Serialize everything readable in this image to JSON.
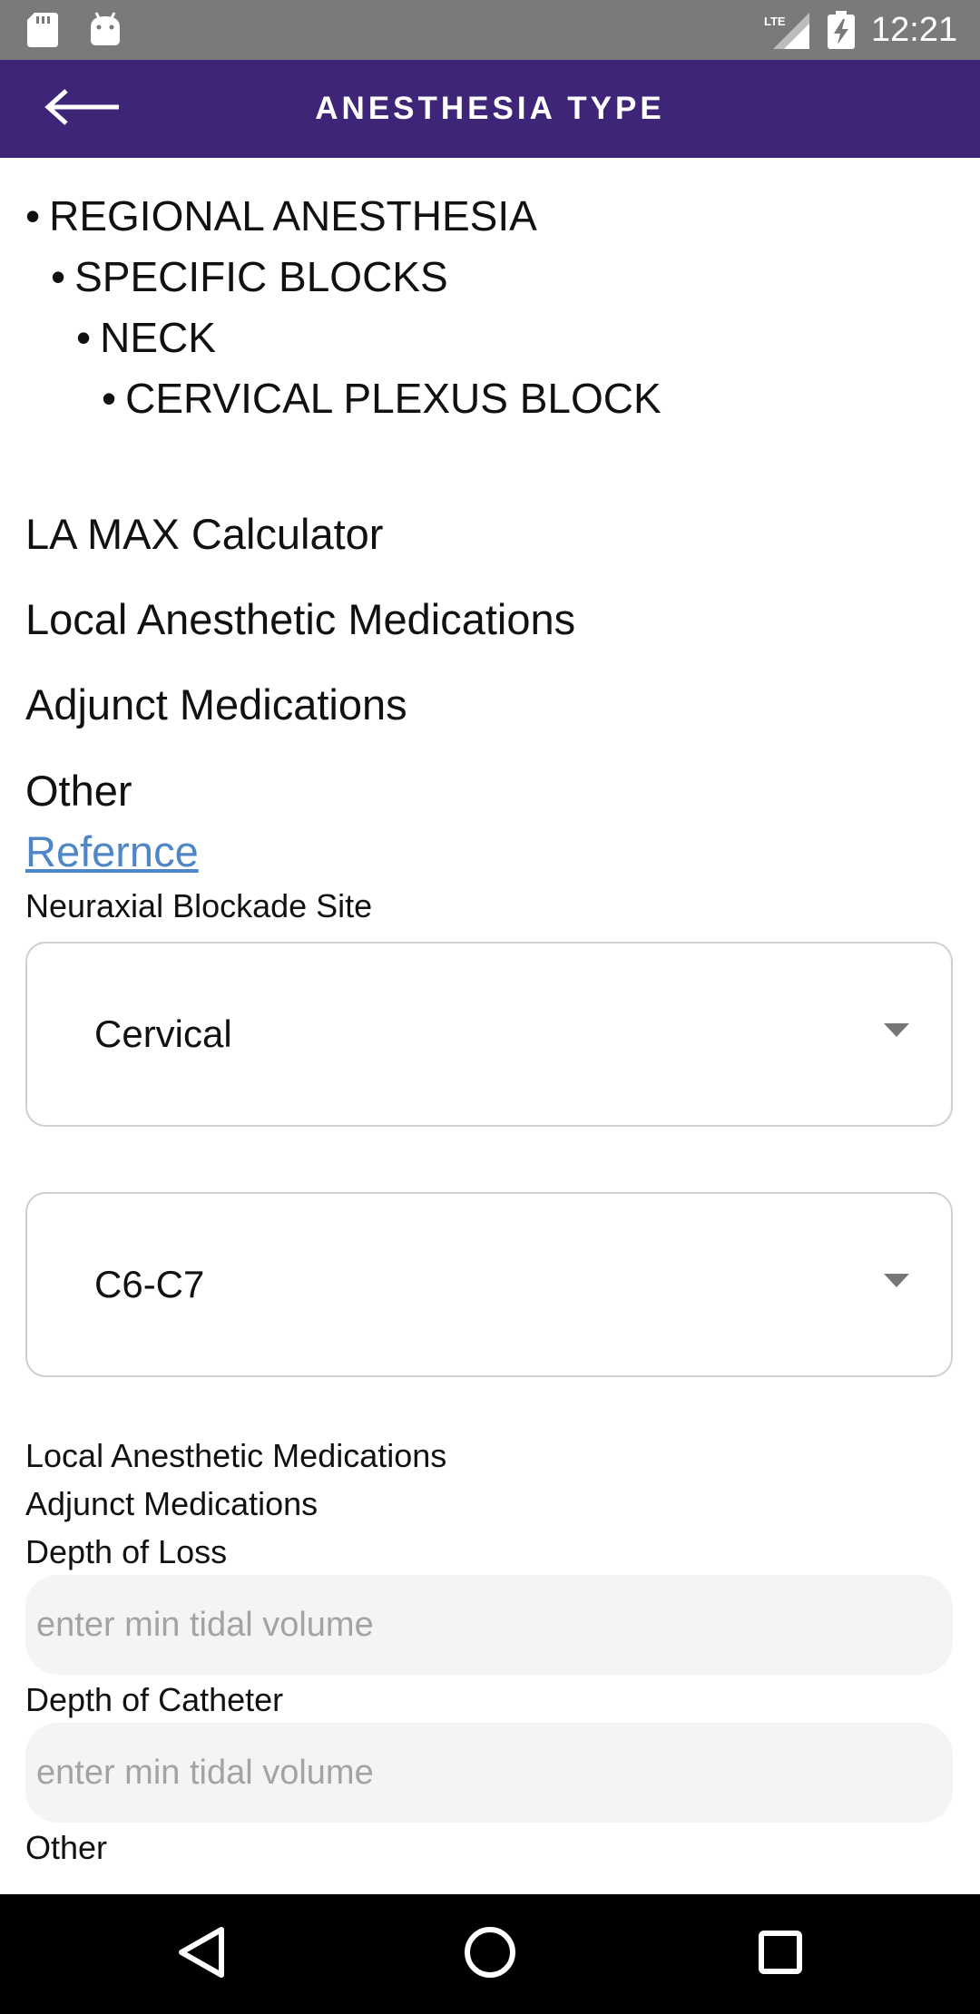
{
  "status_bar": {
    "time": "12:21",
    "network": "LTE",
    "icons": [
      "sd-card-icon",
      "android-icon",
      "lte-signal-icon",
      "battery-charging-icon"
    ]
  },
  "app_bar": {
    "title": "ANESTHESIA TYPE",
    "back_icon": "arrow-left-icon",
    "background_color": "#3f2577"
  },
  "breadcrumb": [
    "REGIONAL ANESTHESIA",
    "SPECIFIC BLOCKS",
    "NECK",
    "CERVICAL PLEXUS BLOCK"
  ],
  "bullet": "•",
  "sections": {
    "la_max_calculator": "LA MAX Calculator",
    "local_anesthetic_medications": "Local Anesthetic Medications",
    "adjunct_medications": "Adjunct Medications",
    "other": "Other"
  },
  "reference_link": {
    "label": "Refernce",
    "color": "#4f86c6"
  },
  "form": {
    "neuraxial_label": "Neuraxial Blockade Site",
    "site_select": {
      "selected": "Cervical"
    },
    "level_select": {
      "selected": "C6-C7"
    },
    "local_anesthetic_label": "Local Anesthetic Medications",
    "adjunct_label": "Adjunct Medications",
    "depth_of_loss": {
      "label": "Depth of Loss",
      "value": "",
      "placeholder": "enter min tidal volume"
    },
    "depth_of_catheter": {
      "label": "Depth of Catheter",
      "value": "",
      "placeholder": "enter min tidal volume"
    },
    "other_label": "Other"
  },
  "nav_bar": {
    "icons": [
      "back-triangle-icon",
      "home-circle-icon",
      "recents-square-icon"
    ]
  }
}
